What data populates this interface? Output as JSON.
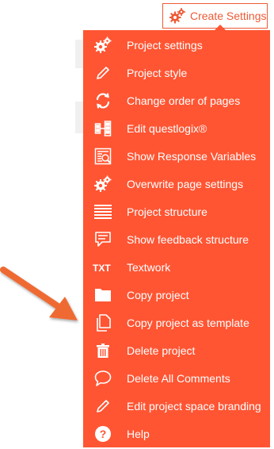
{
  "header": {
    "button_label": "Create Settings",
    "button_icon": "gears-icon",
    "accent_color": "#ee5a36"
  },
  "menu": {
    "background_color": "#ff5533",
    "items": [
      {
        "label": "Project settings",
        "icon": "gears-icon"
      },
      {
        "label": "Project style",
        "icon": "pencil-icon"
      },
      {
        "label": "Change order of pages",
        "icon": "swap-arrows-icon"
      },
      {
        "label": "Edit questlogix®",
        "icon": "logic-blocks-icon"
      },
      {
        "label": "Show Response Variables",
        "icon": "search-list-icon"
      },
      {
        "label": "Overwrite page settings",
        "icon": "gears-icon"
      },
      {
        "label": "Project structure",
        "icon": "lines-icon"
      },
      {
        "label": "Show feedback structure",
        "icon": "feedback-bubble-icon"
      },
      {
        "label": "Textwork",
        "icon": "txt-icon"
      },
      {
        "label": "Copy project",
        "icon": "folder-icon"
      },
      {
        "label": "Copy project as template",
        "icon": "copy-pages-icon"
      },
      {
        "label": "Delete project",
        "icon": "trash-icon"
      },
      {
        "label": "Delete All Comments",
        "icon": "comment-bubble-icon"
      },
      {
        "label": "Edit project space branding",
        "icon": "pencil-icon"
      },
      {
        "label": "Help",
        "icon": "help-circle-icon"
      }
    ]
  },
  "annotation": {
    "arrow_color": "#ee6a33"
  }
}
